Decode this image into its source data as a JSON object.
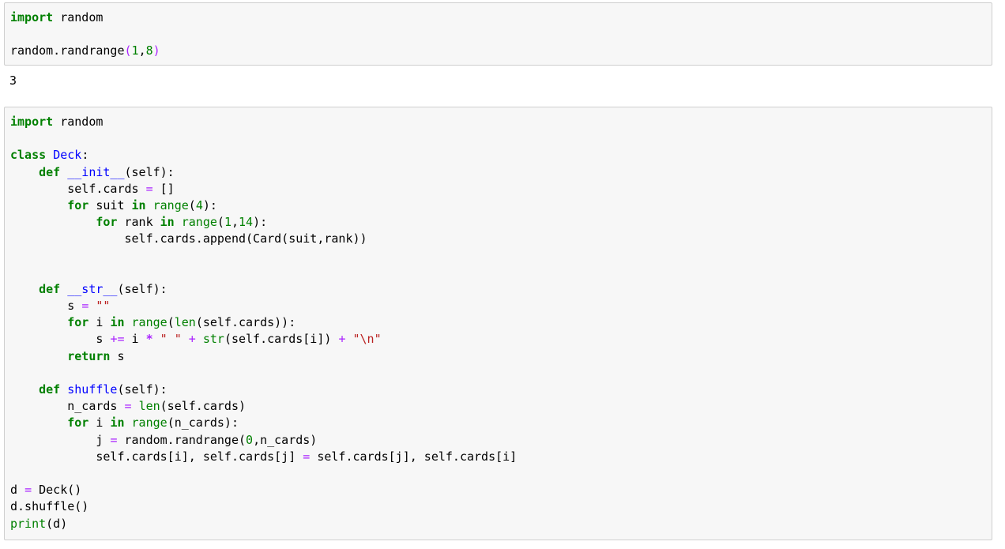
{
  "colors": {
    "cell_background": "#f7f7f7",
    "cell_border": "#cfcfcf",
    "keyword": "#008000",
    "builtin": "#008000",
    "number": "#008000",
    "operator": "#aa22ff",
    "definition": "#0000ff",
    "string": "#ba2121"
  },
  "cells": [
    {
      "input": [
        [
          [
            "kw",
            "import"
          ],
          [
            "t",
            " random"
          ]
        ],
        [],
        [
          [
            "t",
            "random.randrange"
          ],
          [
            "op",
            "("
          ],
          [
            "num",
            "1"
          ],
          [
            "t",
            ","
          ],
          [
            "num",
            "8"
          ],
          [
            "op",
            ")"
          ]
        ]
      ],
      "output": "3"
    },
    {
      "input": [
        [
          [
            "kw",
            "import"
          ],
          [
            "t",
            " random"
          ]
        ],
        [],
        [
          [
            "kw",
            "class"
          ],
          [
            "t",
            " "
          ],
          [
            "def",
            "Deck"
          ],
          [
            "t",
            ":"
          ]
        ],
        [
          [
            "t",
            "    "
          ],
          [
            "kw",
            "def"
          ],
          [
            "t",
            " "
          ],
          [
            "def",
            "__init__"
          ],
          [
            "t",
            "(self):"
          ]
        ],
        [
          [
            "t",
            "        self.cards "
          ],
          [
            "op",
            "="
          ],
          [
            "t",
            " []"
          ]
        ],
        [
          [
            "t",
            "        "
          ],
          [
            "kw",
            "for"
          ],
          [
            "t",
            " suit "
          ],
          [
            "kw",
            "in"
          ],
          [
            "t",
            " "
          ],
          [
            "bi",
            "range"
          ],
          [
            "t",
            "("
          ],
          [
            "num",
            "4"
          ],
          [
            "t",
            "):"
          ]
        ],
        [
          [
            "t",
            "            "
          ],
          [
            "kw",
            "for"
          ],
          [
            "t",
            " rank "
          ],
          [
            "kw",
            "in"
          ],
          [
            "t",
            " "
          ],
          [
            "bi",
            "range"
          ],
          [
            "t",
            "("
          ],
          [
            "num",
            "1"
          ],
          [
            "t",
            ","
          ],
          [
            "num",
            "14"
          ],
          [
            "t",
            "):"
          ]
        ],
        [
          [
            "t",
            "                self.cards.append(Card(suit,rank))"
          ]
        ],
        [],
        [],
        [
          [
            "t",
            "    "
          ],
          [
            "kw",
            "def"
          ],
          [
            "t",
            " "
          ],
          [
            "def",
            "__str__"
          ],
          [
            "t",
            "(self):"
          ]
        ],
        [
          [
            "t",
            "        s "
          ],
          [
            "op",
            "="
          ],
          [
            "t",
            " "
          ],
          [
            "str",
            "\"\""
          ]
        ],
        [
          [
            "t",
            "        "
          ],
          [
            "kw",
            "for"
          ],
          [
            "t",
            " i "
          ],
          [
            "kw",
            "in"
          ],
          [
            "t",
            " "
          ],
          [
            "bi",
            "range"
          ],
          [
            "t",
            "("
          ],
          [
            "bi",
            "len"
          ],
          [
            "t",
            "(self.cards)):"
          ]
        ],
        [
          [
            "t",
            "            s "
          ],
          [
            "op",
            "+="
          ],
          [
            "t",
            " i "
          ],
          [
            "opb",
            "*"
          ],
          [
            "t",
            " "
          ],
          [
            "str",
            "\" \""
          ],
          [
            "t",
            " "
          ],
          [
            "op",
            "+"
          ],
          [
            "t",
            " "
          ],
          [
            "bi",
            "str"
          ],
          [
            "t",
            "(self.cards[i]) "
          ],
          [
            "op",
            "+"
          ],
          [
            "t",
            " "
          ],
          [
            "str",
            "\"\\n\""
          ]
        ],
        [
          [
            "t",
            "        "
          ],
          [
            "kw",
            "return"
          ],
          [
            "t",
            " s"
          ]
        ],
        [],
        [
          [
            "t",
            "    "
          ],
          [
            "kw",
            "def"
          ],
          [
            "t",
            " "
          ],
          [
            "def",
            "shuffle"
          ],
          [
            "t",
            "(self):"
          ]
        ],
        [
          [
            "t",
            "        n_cards "
          ],
          [
            "op",
            "="
          ],
          [
            "t",
            " "
          ],
          [
            "bi",
            "len"
          ],
          [
            "t",
            "(self.cards)"
          ]
        ],
        [
          [
            "t",
            "        "
          ],
          [
            "kw",
            "for"
          ],
          [
            "t",
            " i "
          ],
          [
            "kw",
            "in"
          ],
          [
            "t",
            " "
          ],
          [
            "bi",
            "range"
          ],
          [
            "t",
            "(n_cards):"
          ]
        ],
        [
          [
            "t",
            "            j "
          ],
          [
            "op",
            "="
          ],
          [
            "t",
            " random.randrange("
          ],
          [
            "num",
            "0"
          ],
          [
            "t",
            ",n_cards)"
          ]
        ],
        [
          [
            "t",
            "            self.cards[i], self.cards[j] "
          ],
          [
            "op",
            "="
          ],
          [
            "t",
            " self.cards[j], self.cards[i]"
          ]
        ],
        [],
        [
          [
            "t",
            "d "
          ],
          [
            "op",
            "="
          ],
          [
            "t",
            " Deck()"
          ]
        ],
        [
          [
            "t",
            "d.shuffle()"
          ]
        ],
        [
          [
            "bi",
            "print"
          ],
          [
            "t",
            "(d)"
          ]
        ]
      ]
    }
  ]
}
